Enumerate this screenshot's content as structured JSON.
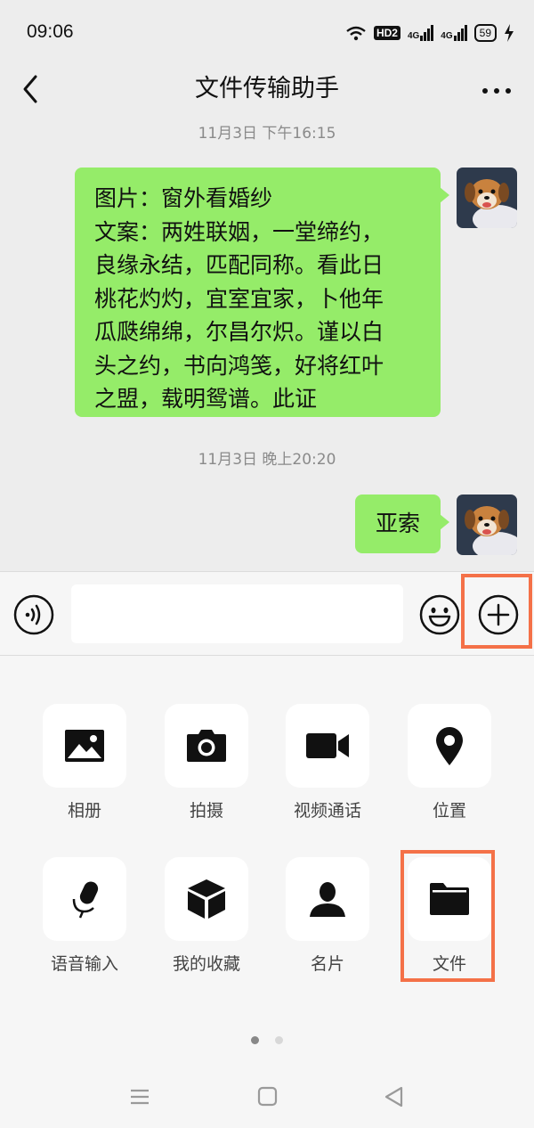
{
  "status_bar": {
    "time": "09:06",
    "hd": "HD2",
    "network_1": "4G",
    "network_2": "4G",
    "battery": "59"
  },
  "header": {
    "title": "文件传输助手",
    "back_icon": "chevron-left-icon",
    "more_icon": "more-dots-icon"
  },
  "messages": [
    {
      "timestamp": "11月3日 下午16:15",
      "text": "图片：窗外看婚纱\n文案：两姓联姻，一堂缔约，\n良缘永结，匹配同称。看此日\n桃花灼灼，宜室宜家，卜他年\n瓜瓞绵绵，尔昌尔炽。谨以白\n头之约，书向鸿笺，好将红叶\n之盟，载明鸳谱。此证",
      "sender": "self"
    },
    {
      "timestamp": "11月3日 晚上20:20",
      "text": "亚索",
      "sender": "self"
    }
  ],
  "input_bar": {
    "value": "",
    "placeholder": ""
  },
  "panel": {
    "items": [
      {
        "label": "相册",
        "icon": "image-icon"
      },
      {
        "label": "拍摄",
        "icon": "camera-icon"
      },
      {
        "label": "视频通话",
        "icon": "video-camera-icon"
      },
      {
        "label": "位置",
        "icon": "location-pin-icon"
      },
      {
        "label": "语音输入",
        "icon": "microphone-icon"
      },
      {
        "label": "我的收藏",
        "icon": "cube-icon"
      },
      {
        "label": "名片",
        "icon": "person-icon"
      },
      {
        "label": "文件",
        "icon": "folder-icon"
      }
    ],
    "page_count": 2,
    "active_page": 1
  },
  "colors": {
    "bubble": "#95ec69",
    "highlight": "#f47148",
    "background": "#ededed"
  }
}
